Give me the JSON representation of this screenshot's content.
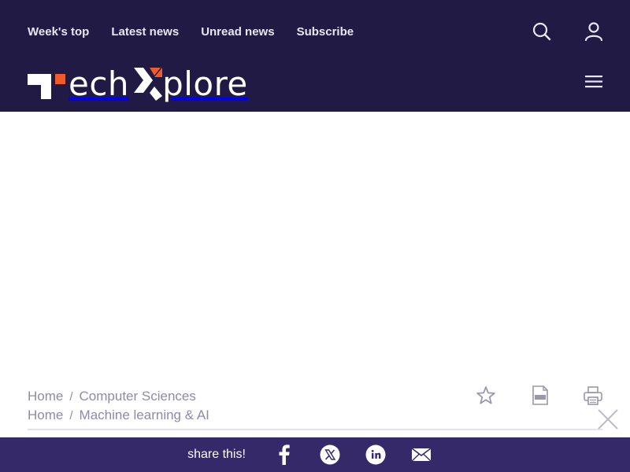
{
  "header": {
    "nav": [
      "Week's top",
      "Latest news",
      "Unread news",
      "Subscribe"
    ],
    "logo": {
      "text_before": "ech",
      "text_after": "plore"
    },
    "icons": {
      "search": "search-icon",
      "user": "user-icon",
      "menu": "hamburger-menu-icon"
    }
  },
  "breadcrumbs": [
    [
      "Home",
      "Computer Sciences"
    ],
    [
      "Home",
      "Machine learning & AI"
    ]
  ],
  "breadcrumb_separator": "/",
  "actions": {
    "favorite": "star-icon",
    "pdf": "pdf-icon",
    "print": "printer-icon",
    "close": "close-icon"
  },
  "share": {
    "label": "share this!",
    "networks": [
      "facebook-icon",
      "x-icon",
      "linkedin-icon",
      "email-icon"
    ]
  },
  "colors": {
    "header_bg": "#211a44",
    "share_bar_bg": "#35296a",
    "accent": "#f15a29",
    "muted_text": "#8f8aa8"
  }
}
